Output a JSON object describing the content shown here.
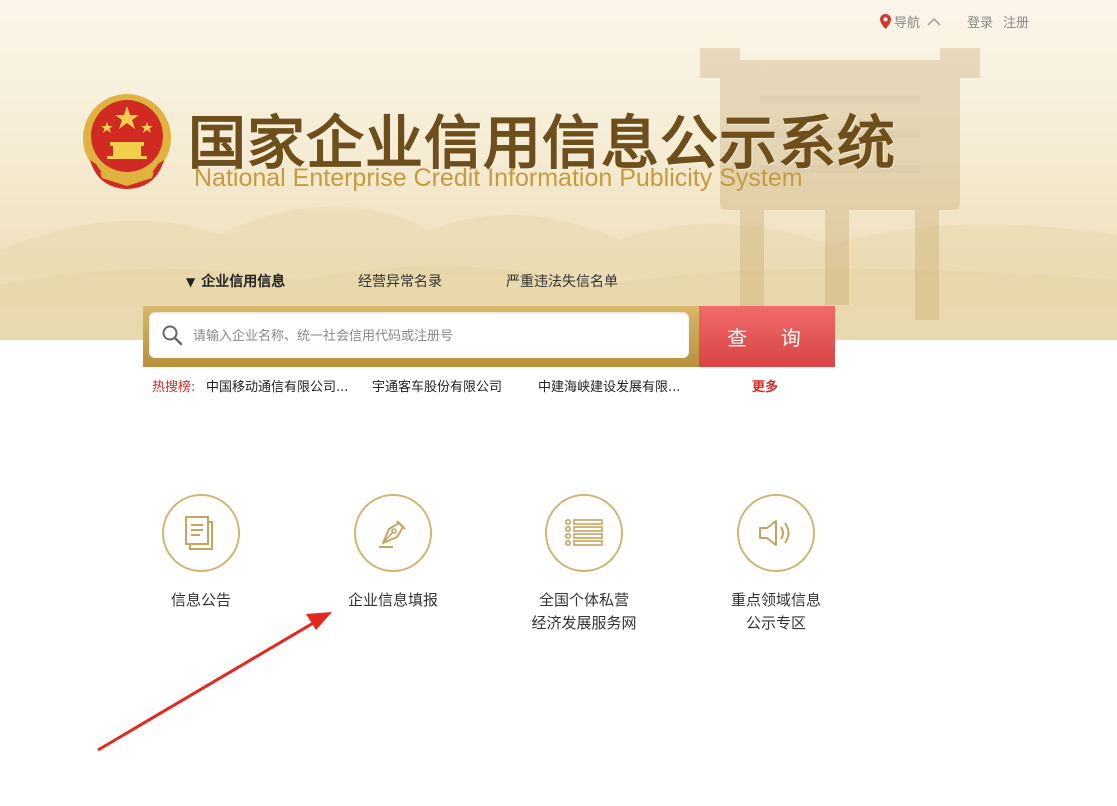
{
  "topbar": {
    "nav_label": "导航",
    "login_label": "登录",
    "register_label": "注册"
  },
  "header": {
    "title_cn": "国家企业信用信息公示系统",
    "title_en": "National Enterprise Credit Information Publicity System"
  },
  "tabs": [
    {
      "label": "企业信用信息",
      "active": true
    },
    {
      "label": "经营异常名录",
      "active": false
    },
    {
      "label": "严重违法失信名单",
      "active": false
    }
  ],
  "search": {
    "placeholder": "请输入企业名称、统一社会信用代码或注册号",
    "value": "",
    "button_label": "查 询"
  },
  "hot": {
    "label": "热搜榜:",
    "items": [
      "中国移动通信有限公司...",
      "宇通客车股份有限公司",
      "中建海峡建设发展有限..."
    ],
    "more_label": "更多"
  },
  "features": [
    {
      "icon": "document-icon",
      "label": "信息公告"
    },
    {
      "icon": "pen-icon",
      "label": "企业信息填报"
    },
    {
      "icon": "list-icon",
      "line1": "全国个体私营",
      "line2": "经济发展服务网"
    },
    {
      "icon": "speaker-icon",
      "line1": "重点领域信息",
      "line2": "公示专区"
    }
  ],
  "colors": {
    "accent_red": "#d94444",
    "gold": "#c49b3f",
    "brown_title": "#6e4f1b"
  }
}
